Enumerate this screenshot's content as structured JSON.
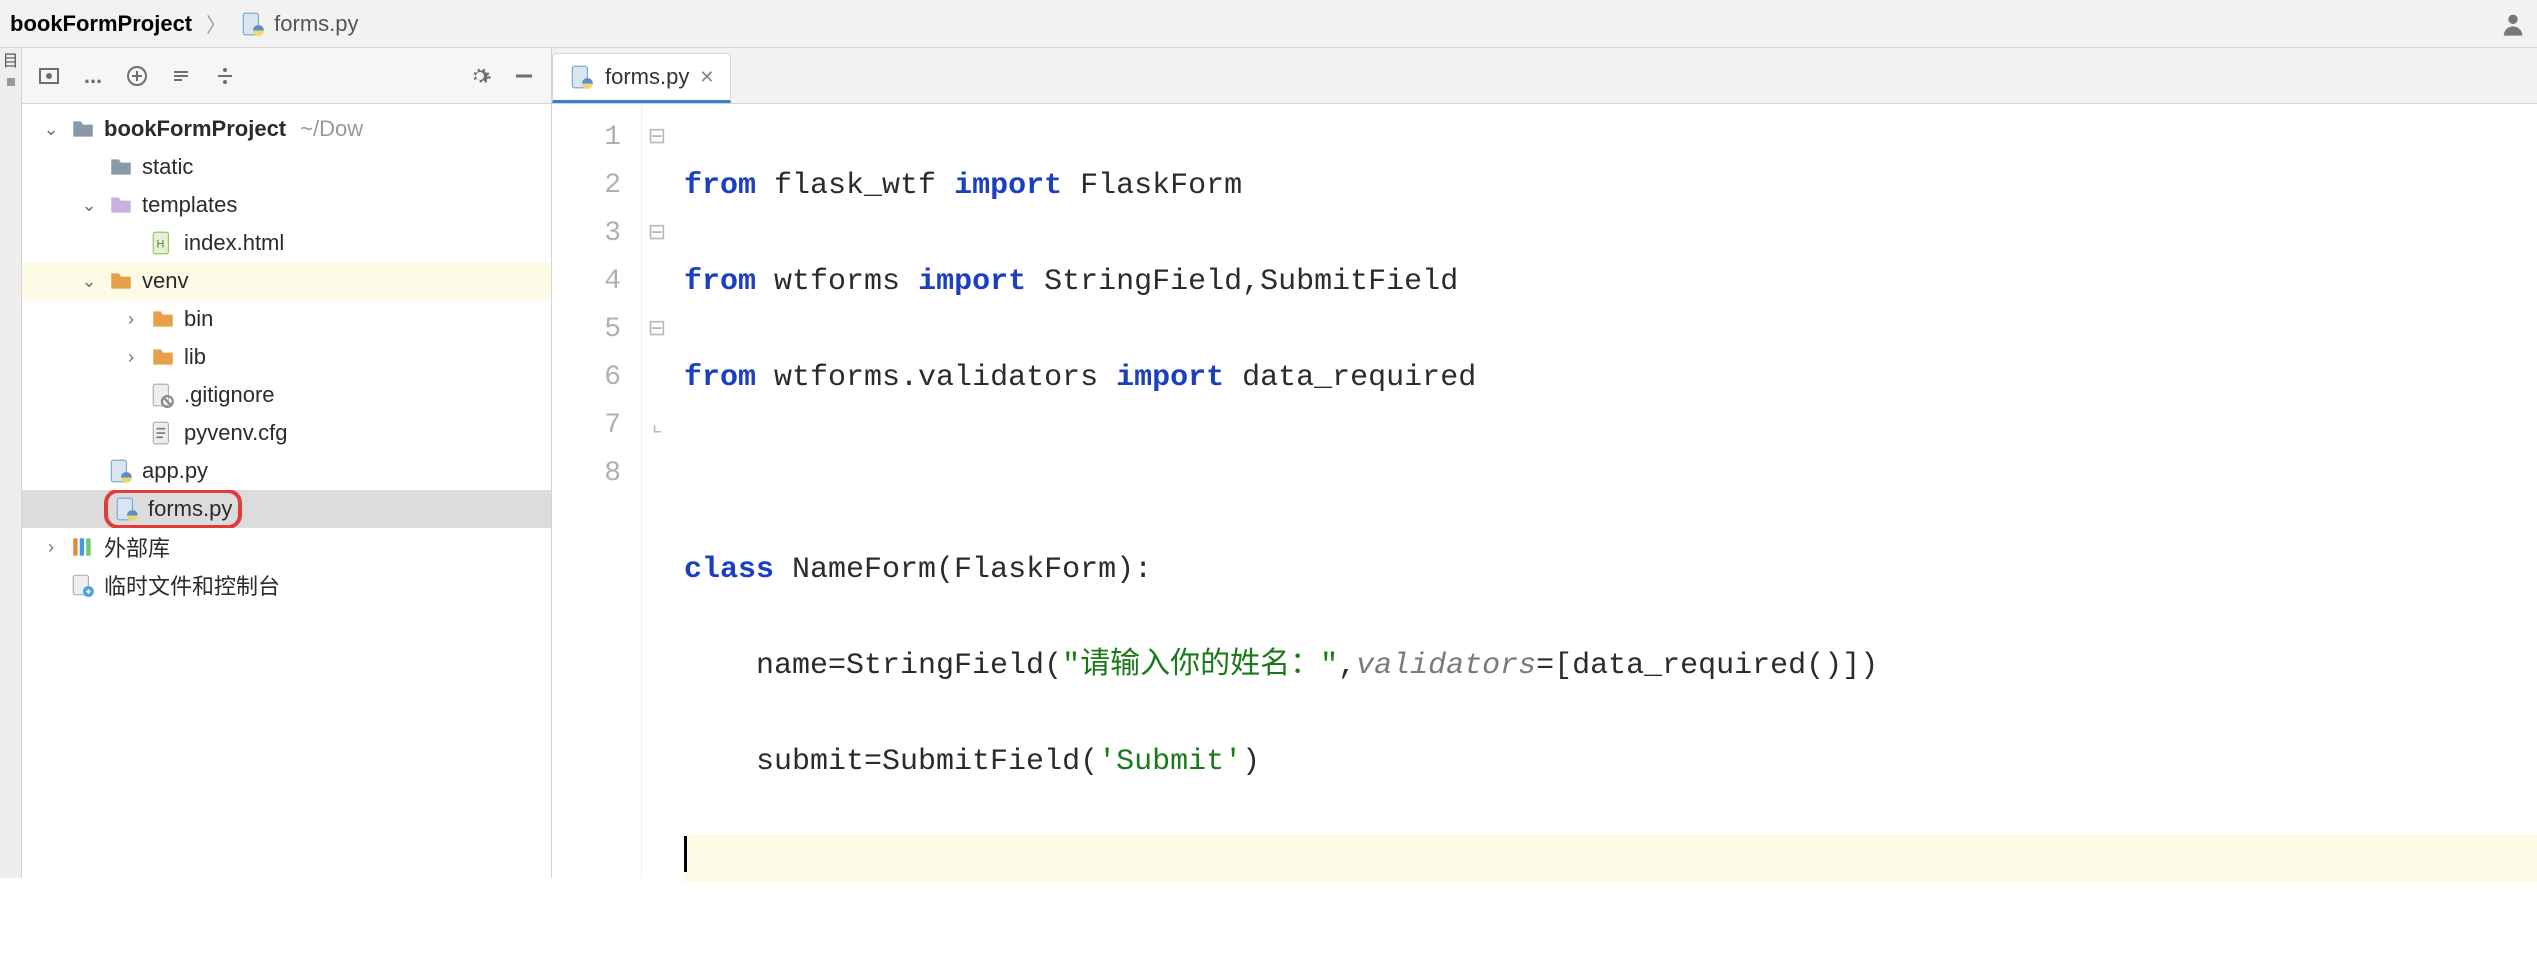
{
  "breadcrumb": {
    "project": "bookFormProject",
    "file": "forms.py"
  },
  "toolbar": {
    "ellipsis": "..."
  },
  "tree": {
    "root": {
      "name": "bookFormProject",
      "path": "~/Dow"
    },
    "static": "static",
    "templates": "templates",
    "index_html": "index.html",
    "venv": "venv",
    "bin": "bin",
    "lib": "lib",
    "gitignore": ".gitignore",
    "pyvenv": "pyvenv.cfg",
    "app_py": "app.py",
    "forms_py": "forms.py",
    "external": "外部库",
    "scratches": "临时文件和控制台"
  },
  "tab": {
    "label": "forms.py"
  },
  "gutter": [
    "1",
    "2",
    "3",
    "4",
    "5",
    "6",
    "7",
    "8"
  ],
  "code": {
    "l1": {
      "kw1": "from",
      "mod": "flask_wtf",
      "kw2": "import",
      "sym": "FlaskForm"
    },
    "l2": {
      "kw1": "from",
      "mod": "wtforms",
      "kw2": "import",
      "sym": "StringField,SubmitField"
    },
    "l3": {
      "kw1": "from",
      "mod": "wtforms.validators",
      "kw2": "import",
      "sym": "data_required"
    },
    "l5": {
      "kw": "class",
      "name": "NameForm(FlaskForm):"
    },
    "l6": {
      "lhs": "name=StringField(",
      "str": "\"请输入你的姓名：\"",
      "comma": ",",
      "arg": "validators",
      "rest": "=[data_required()])"
    },
    "l7": {
      "lhs": "submit=SubmitField(",
      "str": "'Submit'",
      "rest": ")"
    }
  }
}
